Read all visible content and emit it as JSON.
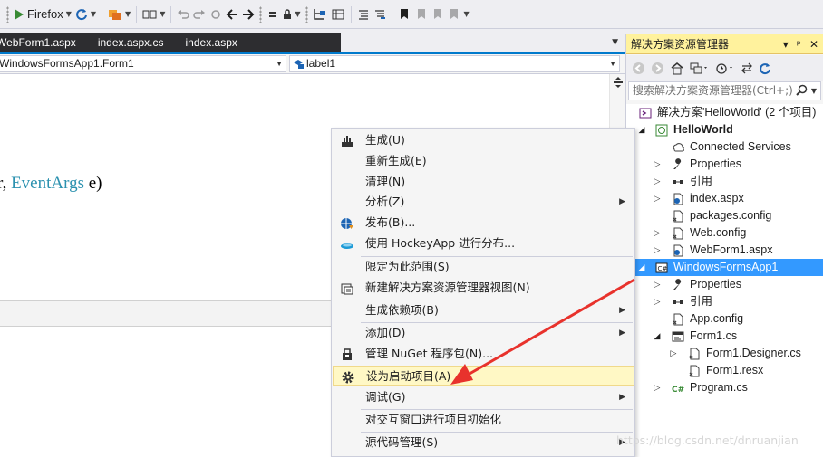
{
  "toolbar": {
    "browser_label": "Firefox",
    "icons": [
      "play-icon",
      "refresh-icon",
      "browser-link-icon",
      "cycle-icon",
      "comment-icon",
      "nav-back-icon",
      "nav-forward-icon",
      "bookmark-icon"
    ]
  },
  "editor": {
    "tabs": [
      "WebForm1.aspx",
      "index.aspx.cs",
      "index.aspx"
    ],
    "nav_left": "WindowsFormsApp1.Form1",
    "nav_right": "label1",
    "code": {
      "prefix": "r, ",
      "type": "EventArgs",
      "suffix": " e)"
    }
  },
  "solution_explorer": {
    "title": "解决方案资源管理器",
    "title_buttons": [
      "▾",
      "ᵖ",
      "✕"
    ],
    "search_placeholder": "搜索解决方案资源管理器(Ctrl+;)",
    "tree": [
      {
        "label": "解决方案'HelloWorld' (2 个项目)",
        "icon": "solution-icon"
      },
      {
        "label": "HelloWorld",
        "icon": "web-project-icon"
      },
      {
        "label": "Connected Services",
        "icon": "connected-services-icon"
      },
      {
        "label": "Properties",
        "icon": "wrench-icon"
      },
      {
        "label": "引用",
        "icon": "references-icon"
      },
      {
        "label": "index.aspx",
        "icon": "aspx-icon"
      },
      {
        "label": "packages.config",
        "icon": "config-icon"
      },
      {
        "label": "Web.config",
        "icon": "config-icon"
      },
      {
        "label": "WebForm1.aspx",
        "icon": "aspx-icon"
      },
      {
        "label": "WindowsFormsApp1",
        "icon": "csharp-project-icon"
      },
      {
        "label": "Properties",
        "icon": "wrench-icon"
      },
      {
        "label": "引用",
        "icon": "references-icon"
      },
      {
        "label": "App.config",
        "icon": "config-icon"
      },
      {
        "label": "Form1.cs",
        "icon": "form-icon"
      },
      {
        "label": "Form1.Designer.cs",
        "icon": "cs-file-icon"
      },
      {
        "label": "Form1.resx",
        "icon": "resx-icon"
      },
      {
        "label": "Program.cs",
        "icon": "csharp-file-icon"
      }
    ]
  },
  "context_menu": {
    "items": [
      {
        "label": "生成(U)",
        "icon": "build-icon"
      },
      {
        "label": "重新生成(E)"
      },
      {
        "label": "清理(N)"
      },
      {
        "label": "分析(Z)",
        "submenu": true
      },
      {
        "label": "发布(B)...",
        "icon": "publish-globe-icon"
      },
      {
        "label": "使用 HockeyApp 进行分布...",
        "icon": "hockeyapp-icon"
      },
      {
        "label": "限定为此范围(S)"
      },
      {
        "label": "新建解决方案资源管理器视图(N)",
        "icon": "new-view-icon"
      },
      {
        "label": "生成依赖项(B)",
        "submenu": true
      },
      {
        "label": "添加(D)",
        "submenu": true
      },
      {
        "label": "管理 NuGet 程序包(N)...",
        "icon": "nuget-icon"
      },
      {
        "label": "设为启动项目(A)",
        "icon": "gear-icon"
      },
      {
        "label": "调试(G)",
        "submenu": true
      },
      {
        "label": "对交互窗口进行项目初始化"
      },
      {
        "label": "源代码管理(S)",
        "submenu": true
      }
    ]
  },
  "annotation": {
    "color": "#e8322c"
  },
  "watermark": "https://blog.csdn.net/dnruanjian",
  "colors": {
    "accent": "#007acc",
    "selection": "#3399ff",
    "highlight": "#fff29d"
  }
}
